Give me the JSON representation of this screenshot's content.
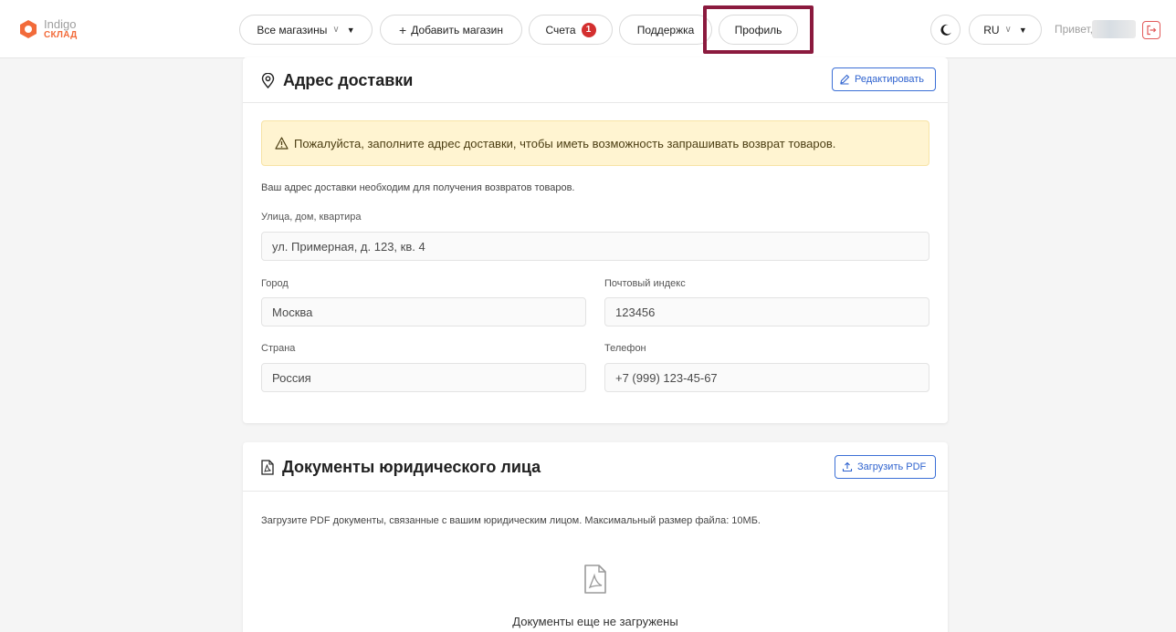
{
  "header": {
    "logo": {
      "line1": "Indigo",
      "line2": "СКЛАД",
      "brand_color": "#f26b3a"
    },
    "nav": {
      "stores_label": "Все магазины",
      "add_store_label": "Добавить магазин",
      "invoices_label": "Счета",
      "invoices_badge": "1",
      "support_label": "Поддержка",
      "profile_label": "Профиль"
    },
    "language_label": "RU",
    "greeting": "Привет,",
    "theme_icon": "moon-icon",
    "logout_icon": "logout-icon",
    "highlight_color": "#8b1a3e"
  },
  "delivery": {
    "title": "Адрес доставки",
    "edit_label": "Редактировать",
    "alert_text": "Пожалуйста, заполните адрес доставки, чтобы иметь возможность запрашивать возврат товаров.",
    "help_text": "Ваш адрес доставки необходим для получения возвратов товаров.",
    "street_label": "Улица, дом, квартира",
    "street_placeholder": "ул. Примерная, д. 123, кв. 4",
    "city_label": "Город",
    "city_placeholder": "Москва",
    "zip_label": "Почтовый индекс",
    "zip_placeholder": "123456",
    "country_label": "Страна",
    "country_placeholder": "Россия",
    "phone_label": "Телефон",
    "phone_placeholder": "+7 (999) 123-45-67"
  },
  "documents": {
    "title": "Документы юридического лица",
    "upload_label": "Загрузить PDF",
    "description": "Загрузите PDF документы, связанные с вашим юридическим лицом. Максимальный размер файла: 10МБ.",
    "empty_text": "Документы еще не загружены"
  },
  "colors": {
    "accent": "#2f63cf",
    "alert_bg": "#fff4d1",
    "badge": "#d32f2f"
  }
}
